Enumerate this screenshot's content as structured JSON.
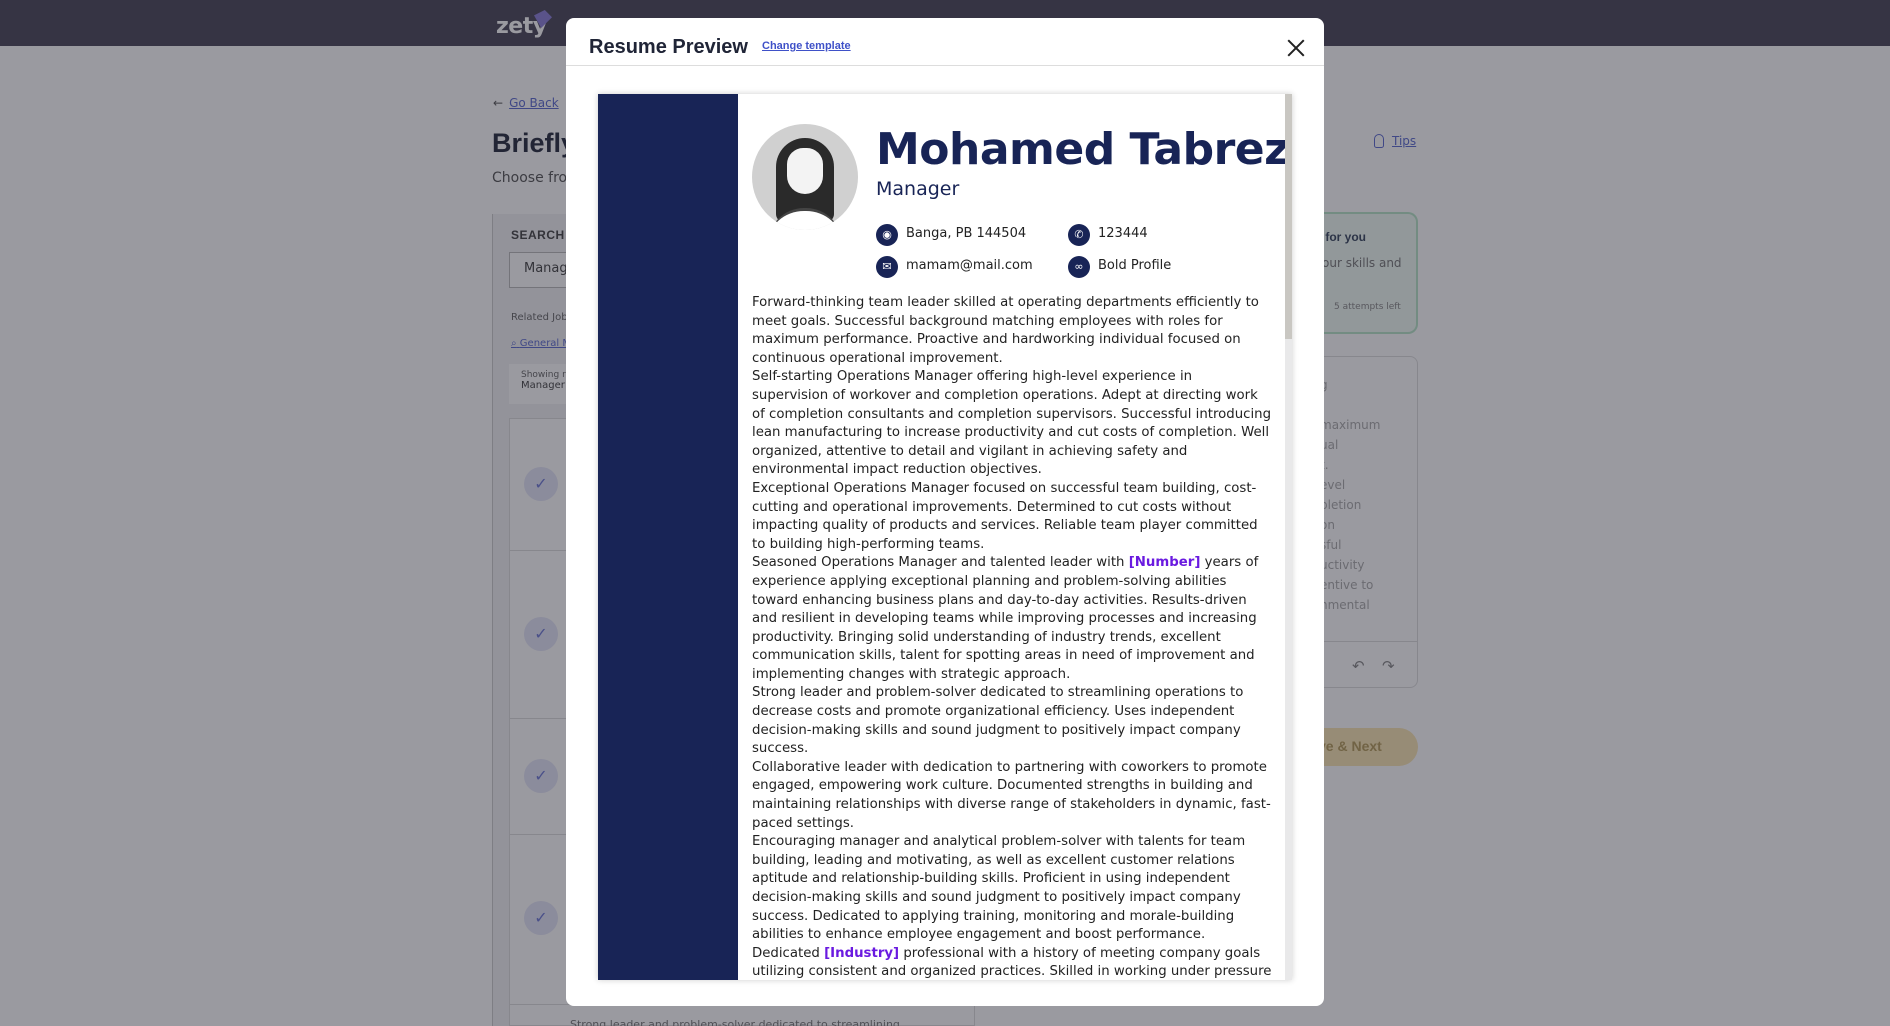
{
  "app": {
    "logo": "zety"
  },
  "background": {
    "go_back": "Go Back",
    "page_title": "Briefly",
    "page_subtitle": "Choose fro",
    "tips": "Tips",
    "search_label": "SEARCH B",
    "search_value": "Manag",
    "related_label": "Related Job",
    "related_link": "General M",
    "showing_label": "Showing r",
    "showing_value": "Manager",
    "bottom_snippet": "Strong leader and problem-solver dedicated to streamlining",
    "ai_card": {
      "title": "t for you",
      "desc": "our skills and",
      "attempts": "5 attempts left"
    },
    "editor_fragment": "g\nl\nmaximum\nual\nt.\nevel\npletion\non\nsful\nuctivity\nentive to\nnmental",
    "save_next": "ve & Next"
  },
  "modal": {
    "title": "Resume Preview",
    "change_template": "Change template"
  },
  "resume": {
    "name": "Mohamed Tabrez",
    "role": "Manager",
    "contacts": [
      {
        "icon": "location-pin-icon",
        "text": "Banga, PB 144504"
      },
      {
        "icon": "phone-icon",
        "text": "123444"
      },
      {
        "icon": "email-icon",
        "text": "mamam@mail.com"
      },
      {
        "icon": "link-icon",
        "text": "Bold Profile"
      }
    ],
    "summary": {
      "p1": "Forward-thinking team leader skilled at operating departments efficiently to meet goals. Successful background matching employees with roles for maximum performance. Proactive and hardworking individual focused on continuous operational improvement.",
      "p2": "Self-starting Operations Manager offering high-level experience in supervision of workover and completion operations. Adept at directing work of completion consultants and completion supervisors. Successful introducing lean manufacturing to increase productivity and cut costs of completion. Well organized, attentive to detail and vigilant in achieving safety and environmental impact reduction objectives.",
      "p3": "Exceptional Operations Manager focused on successful team building, cost-cutting and operational improvements. Determined to cut costs without impacting quality of products and services. Reliable team player committed to building high-performing teams.",
      "p4_before": "Seasoned Operations Manager and talented leader with ",
      "p4_highlight": "[Number]",
      "p4_after": " years of experience applying exceptional planning and problem-solving abilities toward enhancing business plans and day-to-day activities. Results-driven and resilient in developing teams while improving processes and increasing productivity. Bringing solid understanding of industry trends, excellent communication skills, talent for spotting areas in need of improvement and implementing changes with strategic approach.",
      "p5": "Strong leader and problem-solver dedicated to streamlining operations to decrease costs and promote organizational efficiency. Uses independent decision-making skills and sound judgment to positively impact company success.",
      "p6": "Collaborative leader with dedication to partnering with coworkers to promote engaged, empowering work culture. Documented strengths in building and maintaining relationships with diverse range of stakeholders in dynamic, fast-paced settings.",
      "p7": "Encouraging manager and analytical problem-solver with talents for team building, leading and motivating, as well as excellent customer relations aptitude and relationship-building skills. Proficient in using independent decision-making skills and sound judgment to positively impact company success. Dedicated to applying training, monitoring and morale-building abilities to enhance employee engagement and boost performance.",
      "p8_before": "Dedicated ",
      "p8_highlight": "[Industry]",
      "p8_after": " professional with a history of meeting company goals utilizing consistent and organized practices. Skilled in working under pressure and adapting to new situations and challenges to best enhance the organizational"
    }
  },
  "colors": {
    "sidebar": "#182456",
    "highlight": "#6a1ae0",
    "link": "#3f51c8",
    "topbar": "#4a4658"
  }
}
